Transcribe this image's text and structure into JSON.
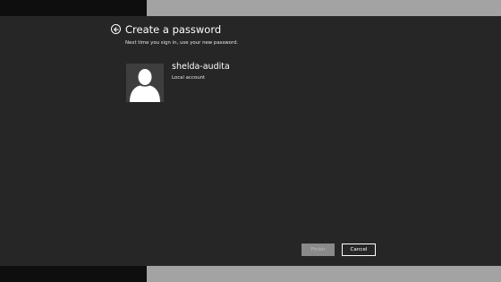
{
  "header": {
    "title": "Create a password",
    "subtitle": "Next time you sign in, use your new password."
  },
  "account": {
    "name": "shelda-audita",
    "type": "Local account"
  },
  "buttons": {
    "finish_label": "Finish",
    "cancel_label": "Cancel"
  },
  "colors": {
    "panel_background": "#262626",
    "text": "#ffffff",
    "disabled_button": "#8a8a8a"
  },
  "icons": {
    "back": "back-arrow-icon",
    "avatar": "user-silhouette-icon"
  }
}
